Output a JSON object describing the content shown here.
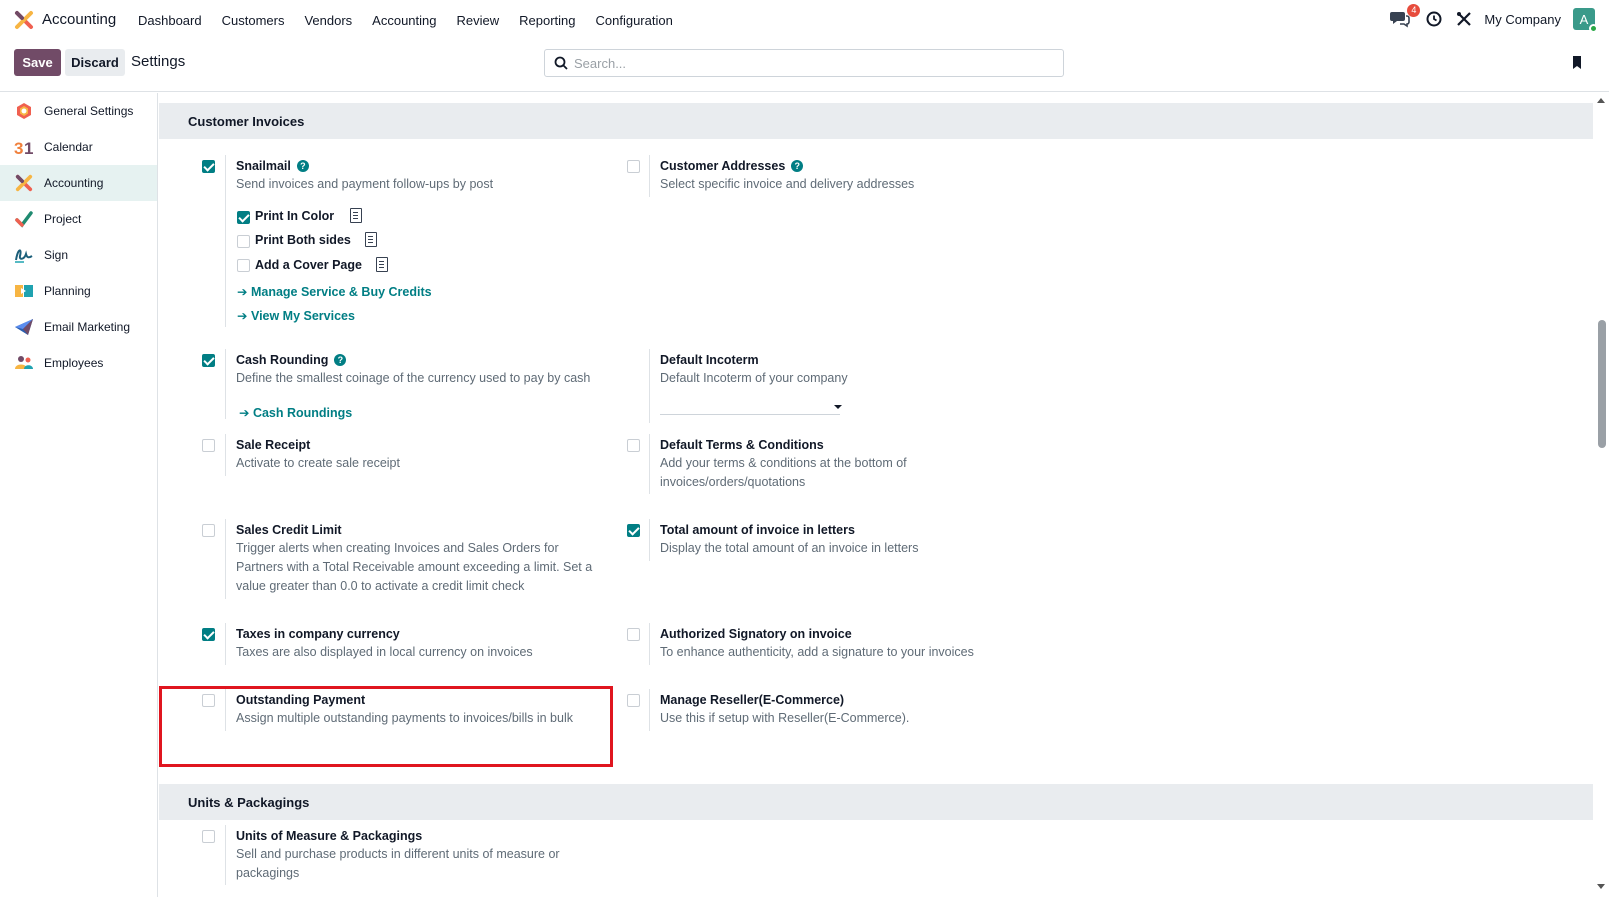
{
  "navbar": {
    "app_name": "Accounting",
    "menu": [
      "Dashboard",
      "Customers",
      "Vendors",
      "Accounting",
      "Review",
      "Reporting",
      "Configuration"
    ],
    "chat_badge": "4",
    "company": "My Company",
    "avatar_letter": "A"
  },
  "control_panel": {
    "save_label": "Save",
    "discard_label": "Discard",
    "title": "Settings",
    "search_placeholder": "Search..."
  },
  "sidebar": {
    "items": [
      {
        "label": "General Settings",
        "icon": "general-settings-icon"
      },
      {
        "label": "Calendar",
        "icon": "calendar-icon"
      },
      {
        "label": "Accounting",
        "icon": "accounting-icon",
        "active": true
      },
      {
        "label": "Project",
        "icon": "project-icon"
      },
      {
        "label": "Sign",
        "icon": "sign-icon"
      },
      {
        "label": "Planning",
        "icon": "planning-icon"
      },
      {
        "label": "Email Marketing",
        "icon": "email-marketing-icon"
      },
      {
        "label": "Employees",
        "icon": "employees-icon"
      }
    ]
  },
  "sections": {
    "customer_invoices": "Customer Invoices",
    "units_packagings": "Units & Packagings"
  },
  "settings": {
    "snailmail": {
      "title": "Snailmail",
      "desc": "Send invoices and payment follow-ups by post",
      "checked": true
    },
    "print_color": {
      "label": "Print In Color",
      "checked": true
    },
    "print_both": {
      "label": "Print Both sides",
      "checked": false
    },
    "cover_page": {
      "label": "Add a Cover Page",
      "checked": false
    },
    "manage_service_link": "Manage Service & Buy Credits",
    "view_services_link": "View My Services",
    "customer_addresses": {
      "title": "Customer Addresses",
      "desc": "Select specific invoice and delivery addresses",
      "checked": false
    },
    "cash_rounding": {
      "title": "Cash Rounding",
      "desc": "Define the smallest coinage of the currency used to pay by cash",
      "checked": true
    },
    "cash_roundings_link": "Cash Roundings",
    "default_incoterm": {
      "title": "Default Incoterm",
      "desc": "Default Incoterm of your company"
    },
    "sale_receipt": {
      "title": "Sale Receipt",
      "desc": "Activate to create sale receipt",
      "checked": false
    },
    "default_terms": {
      "title": "Default Terms & Conditions",
      "desc": "Add your terms & conditions at the bottom of invoices/orders/quotations",
      "checked": false
    },
    "sales_credit_limit": {
      "title": "Sales Credit Limit",
      "desc": "Trigger alerts when creating Invoices and Sales Orders for Partners with a Total Receivable amount exceeding a limit. Set a value greater than 0.0 to activate a credit limit check",
      "checked": false
    },
    "total_in_letters": {
      "title": "Total amount of invoice in letters",
      "desc": "Display the total amount of an invoice in letters",
      "checked": true
    },
    "taxes_company_currency": {
      "title": "Taxes in company currency",
      "desc": "Taxes are also displayed in local currency on invoices",
      "checked": true
    },
    "authorized_signatory": {
      "title": "Authorized Signatory on invoice",
      "desc": "To enhance authenticity, add a signature to your invoices",
      "checked": false
    },
    "outstanding_payment": {
      "title": "Outstanding Payment",
      "desc": "Assign multiple outstanding payments to invoices/bills in bulk",
      "checked": false
    },
    "manage_reseller": {
      "title": "Manage Reseller(E-Commerce)",
      "desc": "Use this if setup with Reseller(E-Commerce).",
      "checked": false
    },
    "units_measure": {
      "title": "Units of Measure & Packagings",
      "desc": "Sell and purchase products in different units of measure or packagings",
      "checked": false
    }
  },
  "colors": {
    "primary": "#714b67",
    "accent": "#017e84",
    "highlight": "#e0151f"
  }
}
